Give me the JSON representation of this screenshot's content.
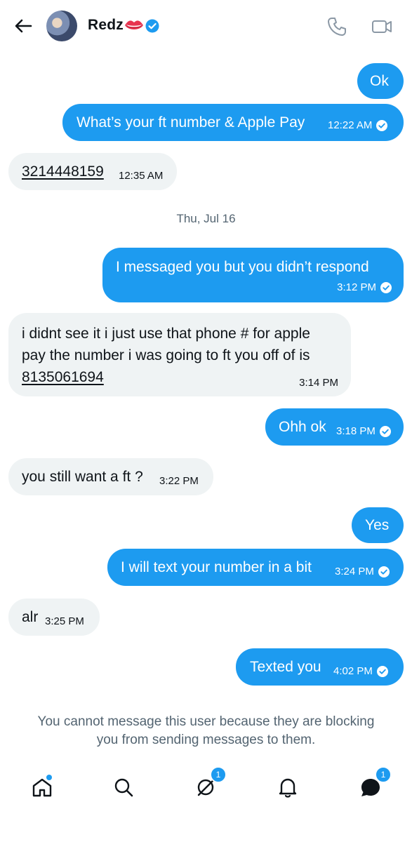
{
  "header": {
    "back_icon": "arrow-left-icon",
    "contact_name": "Redz",
    "name_emoji": "lips-emoji",
    "verified_icon": "verified-badge-icon",
    "call_icon": "phone-icon",
    "video_icon": "video-camera-icon"
  },
  "messages": [
    {
      "dir": "out",
      "text": "Ok",
      "time": ""
    },
    {
      "dir": "out",
      "text": "What’s your ft number & Apple Pay",
      "time": "12:22 AM"
    },
    {
      "dir": "in",
      "text": "3214448159",
      "time": "12:35 AM"
    },
    {
      "dir": "out",
      "text": "I messaged you but you didn’t respond",
      "time": "3:12 PM"
    },
    {
      "dir": "in",
      "line1": "i didnt see it i just use that phone # for apple",
      "line2": "pay the number i was going to ft you off of is",
      "line3": "8135061694",
      "time": "3:14 PM"
    },
    {
      "dir": "out",
      "text": "Ohh ok",
      "time": "3:18 PM"
    },
    {
      "dir": "in",
      "text": "you still want a ft ?",
      "time": "3:22 PM"
    },
    {
      "dir": "out",
      "text": "Yes",
      "time": ""
    },
    {
      "dir": "out",
      "text": "I will text your number in a bit",
      "time": "3:24 PM"
    },
    {
      "dir": "in",
      "text": "alr",
      "time": "3:25 PM"
    },
    {
      "dir": "out",
      "text": "Texted you",
      "time": "4:02 PM"
    }
  ],
  "date_separator": "Thu, Jul 16",
  "blocked_notice": {
    "line1": "You cannot message this user because they are blocking",
    "line2": "you from sending messages to them."
  },
  "nav": {
    "home_icon": "home-icon",
    "search_icon": "search-icon",
    "grok_icon": "grok-icon",
    "grok_badge": "1",
    "notifications_icon": "bell-icon",
    "messages_icon": "messages-icon",
    "messages_badge": "1"
  },
  "colors": {
    "accent": "#1d9bf0",
    "incoming_bubble": "#eff3f4",
    "muted_text": "#536471"
  }
}
